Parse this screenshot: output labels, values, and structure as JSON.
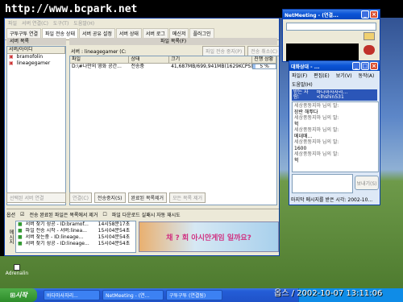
{
  "watermark": "http://www.bcpark.net",
  "main_window": {
    "menu": [
      "파일",
      "서버 연결(C)",
      "도구(T)",
      "도움말(H)"
    ],
    "tabs": [
      "구투구투 연결",
      "파일 전송 상태",
      "서버 공유 설정",
      "서버 상태",
      "서버 로그",
      "메신저",
      "플러그인"
    ],
    "left_title": "서버 목록",
    "left_header": "서버/아이디",
    "servers": [
      "bramofolin",
      "lineagegamer"
    ],
    "right_title": "파일 목록(F)",
    "server_label": "서버 : lineagegamer (C:",
    "pause_button": "파일 전송 중지(P)",
    "cancel_button": "전송 취소(C)",
    "columns": [
      "파일",
      "상태",
      "크기",
      "진행 상황"
    ],
    "files": [
      {
        "file": "D:\\#나만의 영화 공간...",
        "status": "전송중",
        "size": "41,687MB/699,941MB(1629KCPS)",
        "progress": "5 %",
        "progress_value": 5
      }
    ],
    "actions": [
      "선택된 서버 연결",
      "연결(C)",
      "전송중지(S)",
      "완료된 목록제거",
      "모든 목록 제거"
    ],
    "options": {
      "label": "옵션",
      "opt1": "전송 완료된 파일은 목록에서 제거",
      "opt2": "파일 다운로드 실패시 자동 재시도"
    },
    "log_label": "메시지",
    "logs": [
      {
        "text": "서버 찾기 성공 - ID:bramof...",
        "time": "14시58분17초"
      },
      {
        "text": "파일 전송 시작 - 서버:linea...",
        "time": "15시04분54초"
      },
      {
        "text": "서버 찾는중 - ID:lineage...",
        "time": "15시04분54초"
      },
      {
        "text": "서버 찾기 성공 - ID:lineage...",
        "time": "15시04분54초"
      }
    ],
    "banner": "채 ? 회 아시안게임 일까요?"
  },
  "netmeeting": {
    "title": "NetMeeting - (연결..."
  },
  "chat_window": {
    "title": "대화상대 - ...",
    "menu": [
      "파일(F)",
      "편집(E)",
      "보기(V)",
      "동작(A)",
      "도움말(H)"
    ],
    "recipient_label": "받는 사람:",
    "recipient": "바다마사자리... <lhshin531",
    "messages": [
      "세상풍뚱지마 님의 말:",
      "장란 해뿌다",
      "세상풍뚱지마 님의 말:",
      "헉",
      "세상풍뚱지마 님의 말:",
      "메데매...",
      "세상풍뚱지마 님의 말:",
      "1600",
      "세상풍뚱지마 님의 말:",
      "헉"
    ],
    "send_button": "보내기(S)",
    "status": "마지막 메시지를 받은 시각: 2002-10..."
  },
  "desktop_icon": "Adrenalin",
  "taskbar": {
    "start": "시작",
    "buttons": [
      "바다마사자리...",
      "NetMeeting - (연...",
      "구투구투 (연결됨)"
    ],
    "clock": "옵스 / 2002-10-07 13:11:06"
  },
  "colors": {
    "xp_blue": "#0a54d6",
    "face": "#ece9d8",
    "taskbar": "#245dd7"
  }
}
